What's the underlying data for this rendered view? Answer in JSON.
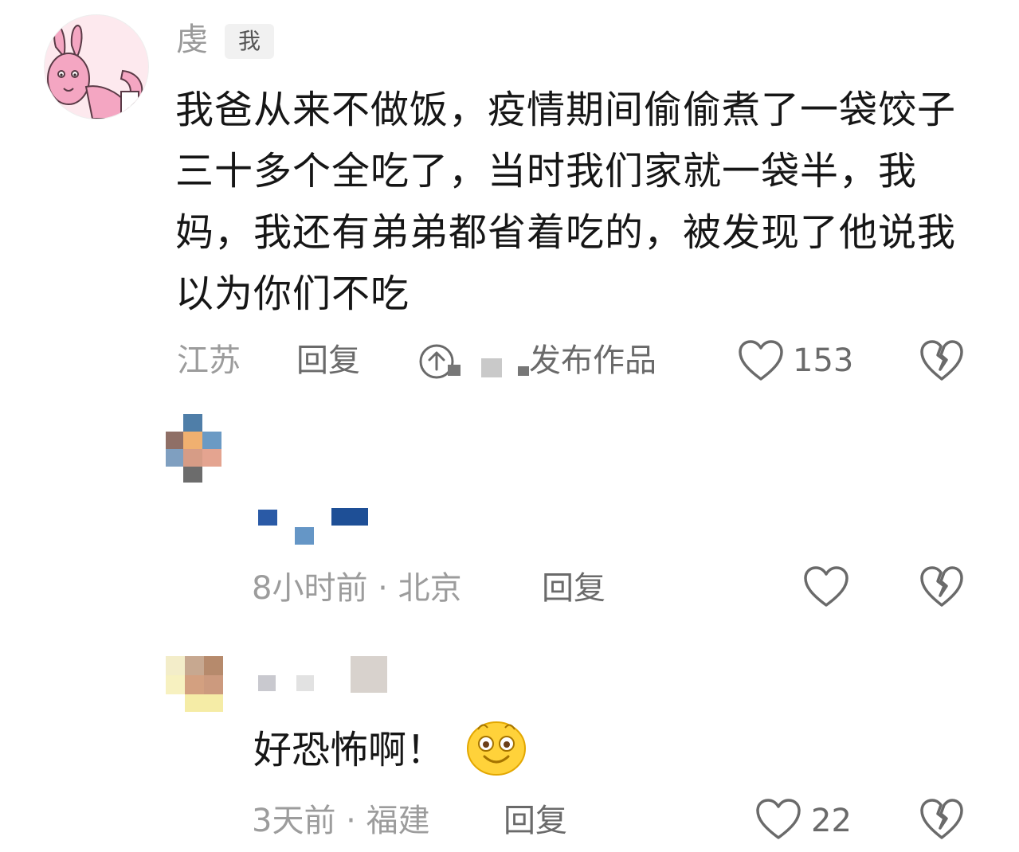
{
  "main_comment": {
    "username": "虔",
    "self_badge": "我",
    "text": "我爸从来不做饭，疫情期间偷偷煮了一袋饺子三十多个全吃了，当时我们家就一袋半，我妈，我还有弟弟都省着吃的，被发现了他说我以为你们不吃",
    "location": "江苏",
    "reply_label": "回复",
    "publish_label": "发布作品",
    "like_count": "153",
    "icons": {
      "avatar": "rabbit-avatar",
      "publish": "upload-icon",
      "like": "heart-outline-icon",
      "dislike": "broken-heart-icon"
    }
  },
  "replies": [
    {
      "time_location": "8小时前 · 北京",
      "reply_label": "回复",
      "like_count": "",
      "avatar": "pixelated-avatar"
    },
    {
      "text": "好恐怖啊！",
      "emoji": "smiling-face-emoji",
      "time_location": "3天前 · 福建",
      "reply_label": "回复",
      "like_count": "22",
      "avatar": "pixelated-avatar"
    }
  ],
  "colors": {
    "text": "#161616",
    "meta": "#9c9c9c",
    "icon": "#6a6a6a",
    "avatar_bg": "#fde9ee",
    "avatar_pink": "#f4a6c2"
  }
}
